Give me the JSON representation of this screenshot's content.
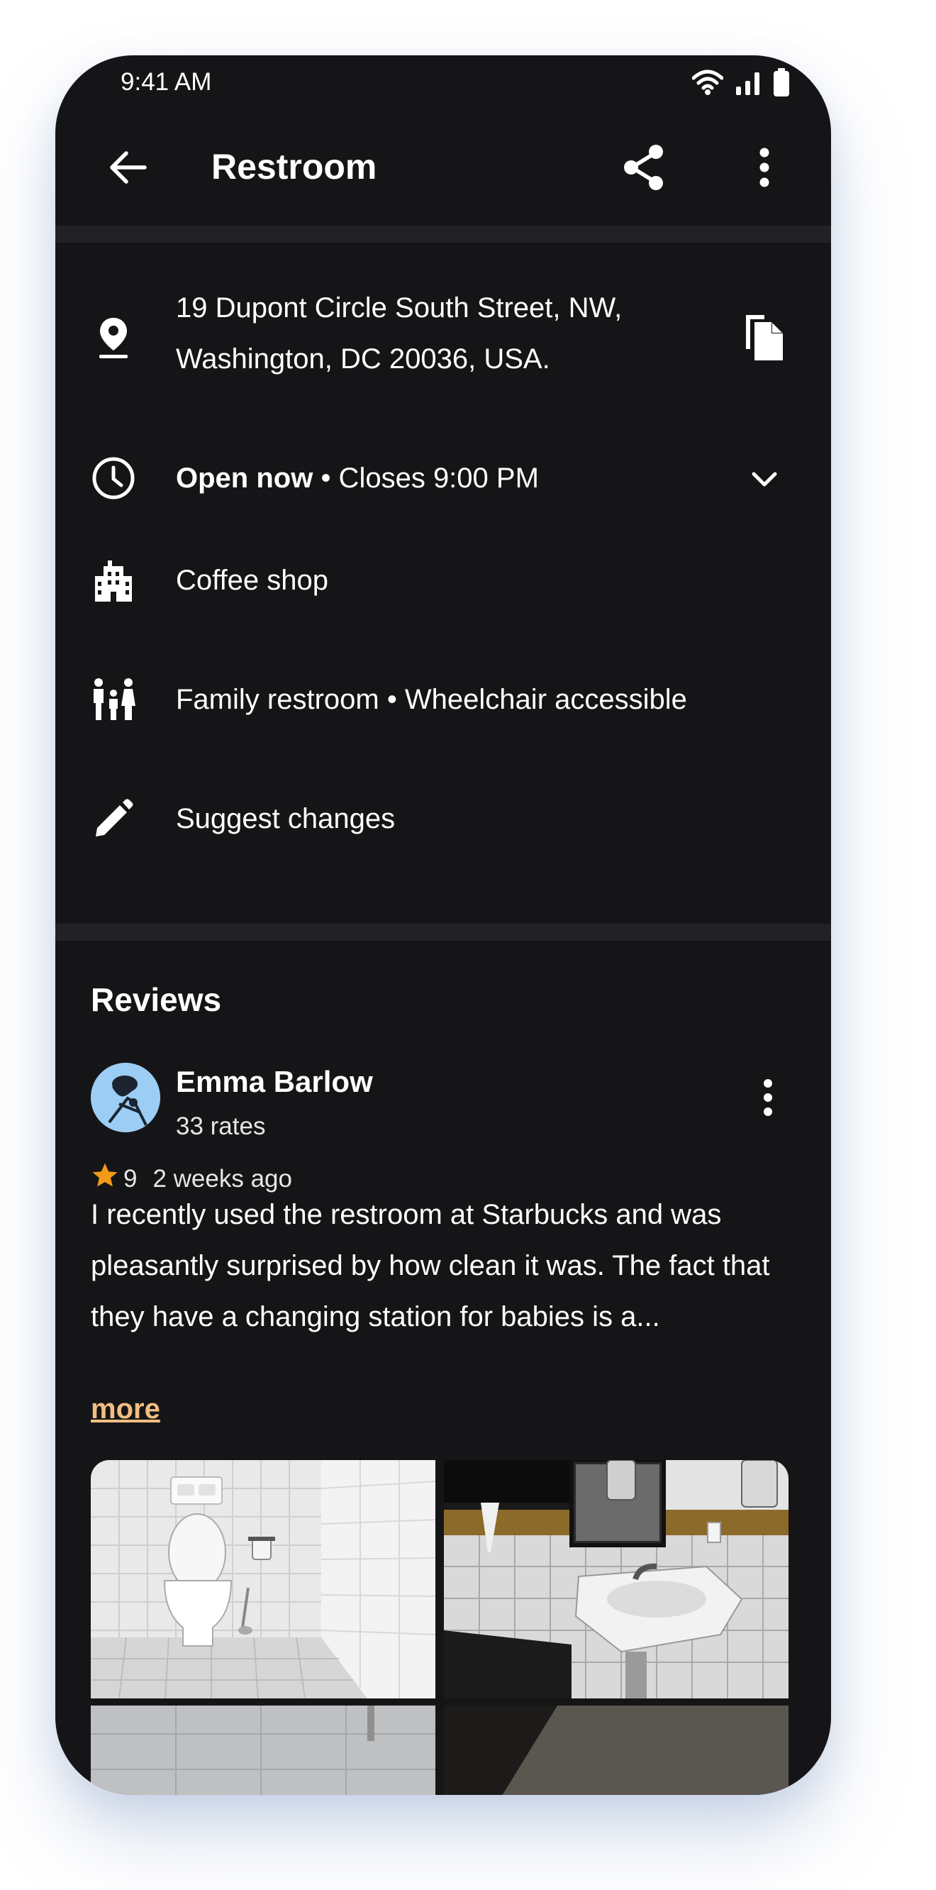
{
  "status_bar": {
    "time": "9:41 AM"
  },
  "app_bar": {
    "title": "Restroom"
  },
  "details": {
    "address_line1": "19 Dupont Circle South Street, NW,",
    "address_line2": "Washington, DC 20036, USA.",
    "hours_status": "Open now",
    "hours_detail": " • Closes 9:00 PM",
    "category": "Coffee shop",
    "features": "Family restroom • Wheelchair accessible",
    "suggest_changes": "Suggest changes"
  },
  "reviews": {
    "title": "Reviews",
    "items": [
      {
        "author": "Emma Barlow",
        "rates": "33 rates",
        "rating": "9",
        "age": "2 weeks ago",
        "text": "I recently used the restroom at Starbucks and was pleasantly surprised by how clean it was. The fact that they have a changing station for babies is a...",
        "more_label": "more"
      }
    ]
  },
  "colors": {
    "background": "#151517",
    "divider": "#222226",
    "link_accent": "#f1be80",
    "star": "#f29a17",
    "avatar_bg": "#9ccdf4"
  },
  "icons": {
    "status": [
      "wifi-icon",
      "signal-icon",
      "battery-icon"
    ],
    "app_bar": [
      "back-arrow-icon",
      "share-icon",
      "more-vertical-icon"
    ],
    "details": [
      "location-pin-icon",
      "copy-icon",
      "clock-icon",
      "chevron-down-icon",
      "building-icon",
      "family-icon",
      "edit-pencil-icon"
    ],
    "review": [
      "more-vertical-icon",
      "star-icon"
    ]
  }
}
